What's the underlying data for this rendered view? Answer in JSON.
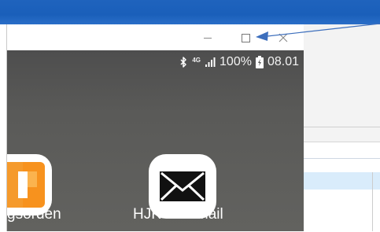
{
  "phone": {
    "status": {
      "network": "4G",
      "battery": "100%",
      "time": "08.01"
    },
    "apps": [
      {
        "label": "gsorden",
        "icon": "orange-app-icon"
      },
      {
        "label": "HJK Webmail",
        "icon": "envelope-icon"
      }
    ]
  },
  "window_controls": [
    "minimize",
    "maximize",
    "close"
  ],
  "colors": {
    "banner": "#1f63bd",
    "arrow": "#3d6fbd",
    "app_orange": "#f7921e"
  }
}
